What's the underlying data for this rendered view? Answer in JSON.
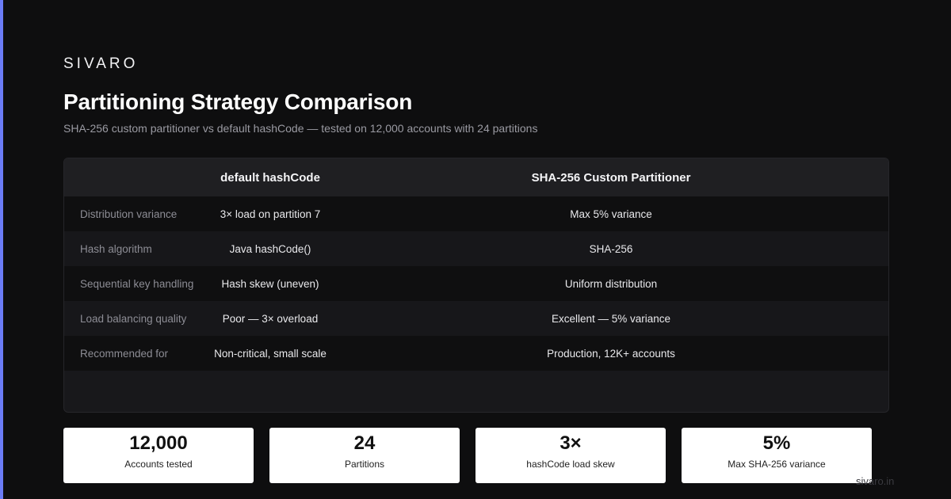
{
  "brand": "SIVARO",
  "title": "Partitioning Strategy Comparison",
  "subtitle": "SHA-256 custom partitioner vs default hashCode — tested on 12,000 accounts with 24 partitions",
  "table": {
    "header": {
      "label": "",
      "a": "default hashCode",
      "b": "SHA-256 Custom Partitioner"
    },
    "rows": [
      {
        "label": "Distribution variance",
        "a": "3× load on partition 7",
        "b": "Max 5% variance"
      },
      {
        "label": "Hash algorithm",
        "a": "Java hashCode()",
        "b": "SHA-256"
      },
      {
        "label": "Sequential key handling",
        "a": "Hash skew (uneven)",
        "b": "Uniform distribution"
      },
      {
        "label": "Load balancing quality",
        "a": "Poor — 3× overload",
        "b": "Excellent — 5% variance"
      },
      {
        "label": "Recommended for",
        "a": "Non-critical, small scale",
        "b": "Production, 12K+ accounts"
      }
    ]
  },
  "stats": [
    {
      "value": "12,000",
      "label": "Accounts tested"
    },
    {
      "value": "24",
      "label": "Partitions"
    },
    {
      "value": "3×",
      "label": "hashCode load skew"
    },
    {
      "value": "5%",
      "label": "Max SHA-256 variance"
    }
  ],
  "watermark": "sivaro.in",
  "colors": {
    "accent": "#6b7cf6",
    "background": "#0e0e0f"
  }
}
